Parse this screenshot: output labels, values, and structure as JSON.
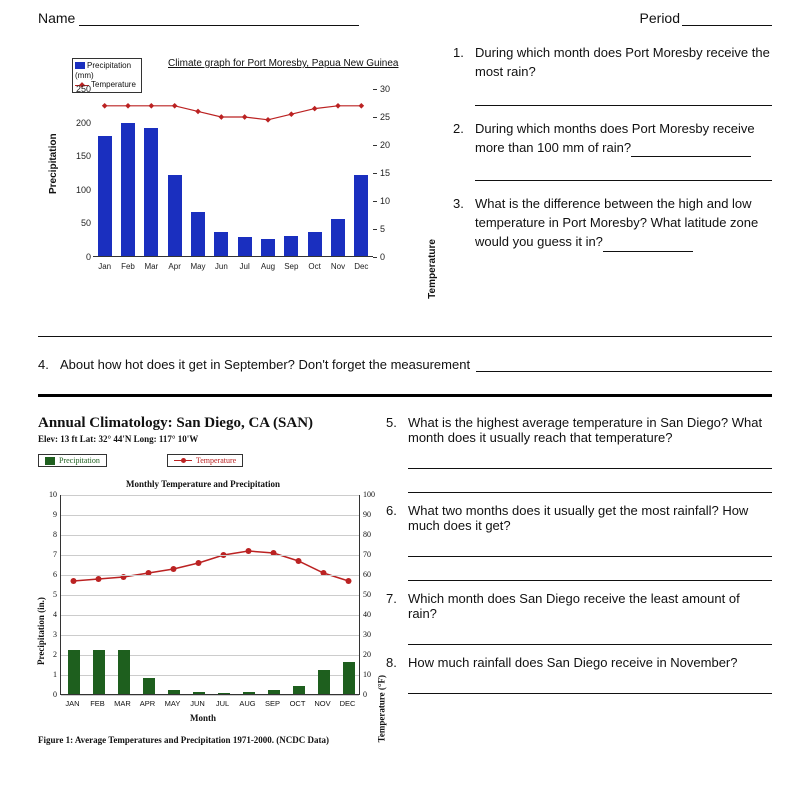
{
  "header": {
    "name_label": "Name",
    "period_label": "Period"
  },
  "chart1": {
    "title": "Climate graph for Port Moresby, Papua New Guinea",
    "legend_precip": "Precipitation (mm)",
    "legend_temp": "Temperature",
    "axis_left": "Precipitation",
    "axis_right": "Temperature",
    "y_left_ticks": [
      0,
      50,
      100,
      150,
      200,
      250
    ],
    "y_right_ticks": [
      0,
      5,
      10,
      15,
      20,
      25,
      30
    ]
  },
  "chart_data": [
    {
      "type": "bar+line",
      "title": "Climate graph for Port Moresby, Papua New Guinea",
      "categories": [
        "Jan",
        "Feb",
        "Mar",
        "Apr",
        "May",
        "Jun",
        "Jul",
        "Aug",
        "Sep",
        "Oct",
        "Nov",
        "Dec"
      ],
      "series": [
        {
          "name": "Precipitation (mm)",
          "axis": "left",
          "type": "bar",
          "values": [
            178,
            198,
            190,
            120,
            65,
            35,
            28,
            25,
            30,
            35,
            55,
            120
          ]
        },
        {
          "name": "Temperature (°C)",
          "axis": "right",
          "type": "line",
          "values": [
            27,
            27,
            27,
            27,
            26,
            25,
            25,
            24.5,
            25.5,
            26.5,
            27,
            27
          ]
        }
      ],
      "ylabel_left": "Precipitation",
      "ylabel_right": "Temperature",
      "ylim_left": [
        0,
        250
      ],
      "ylim_right": [
        0,
        30
      ]
    },
    {
      "type": "bar+line",
      "title": "Monthly Temperature and Precipitation",
      "supertitle": "Annual Climatology: San Diego, CA (SAN)",
      "subtitle": "Elev: 13 ft   Lat: 32° 44'N   Long: 117° 10'W",
      "categories": [
        "JAN",
        "FEB",
        "MAR",
        "APR",
        "MAY",
        "JUN",
        "JUL",
        "AUG",
        "SEP",
        "OCT",
        "NOV",
        "DEC"
      ],
      "series": [
        {
          "name": "Precipitation (in.)",
          "axis": "left",
          "type": "bar",
          "values": [
            2.2,
            2.2,
            2.2,
            0.8,
            0.2,
            0.1,
            0.05,
            0.1,
            0.2,
            0.4,
            1.2,
            1.6
          ]
        },
        {
          "name": "Temperature (°F)",
          "axis": "right",
          "type": "line",
          "values": [
            57,
            58,
            59,
            61,
            63,
            66,
            70,
            72,
            71,
            67,
            61,
            57
          ]
        }
      ],
      "ylabel_left": "Precipitation (in.)",
      "ylabel_right": "Temperature (°F)",
      "xlabel": "Month",
      "ylim_left": [
        0,
        10
      ],
      "ylim_right": [
        0,
        100
      ],
      "caption": "Figure 1: Average Temperatures and Precipitation 1971-2000. (NCDC Data)"
    }
  ],
  "chart2": {
    "title": "Annual Climatology: San Diego, CA (SAN)",
    "subtitle": "Elev: 13 ft   Lat: 32° 44'N   Long: 117° 10'W",
    "legend_precip": "Precipitation",
    "legend_temp": "Temperature",
    "plot_title": "Monthly Temperature and Precipitation",
    "axis_left": "Precipitation (in.)",
    "axis_right": "Temperature (°F)",
    "axis_x": "Month",
    "caption": "Figure 1: Average Temperatures and Precipitation 1971-2000. (NCDC Data)",
    "y_left_ticks": [
      0,
      1,
      2,
      3,
      4,
      5,
      6,
      7,
      8,
      9,
      10
    ],
    "y_right_ticks": [
      0,
      10,
      20,
      30,
      40,
      50,
      60,
      70,
      80,
      90,
      100
    ]
  },
  "questions": {
    "q1": "During which month does Port Moresby receive the most rain?",
    "q2": "During which months does Port Moresby receive more than 100 mm of rain?",
    "q3": "What is the difference between the high and low temperature in Port Moresby? What latitude zone would you guess it in?",
    "q4": "About how hot does it get in September? Don't forget the measurement",
    "q5": "What is the highest average temperature in San Diego? What month does it usually reach that temperature?",
    "q6": "What two months does it usually get the most rainfall? How much does it get?",
    "q7": "Which month does San Diego receive the least amount of rain?",
    "q8": "How much rainfall does San Diego receive in November?"
  }
}
